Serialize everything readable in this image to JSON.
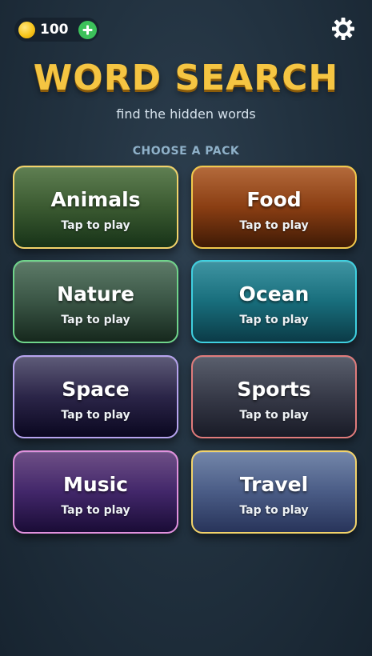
{
  "header": {
    "coins": "100",
    "coin_icon": "coin-icon",
    "add_icon": "plus-circle-icon",
    "settings_icon": "gear-icon"
  },
  "title": "WORD SEARCH",
  "subtitle": "find the hidden words",
  "section_label": "CHOOSE A PACK",
  "packs": [
    {
      "name": "Animals",
      "sub": "Tap to play",
      "border": "#f2d36a"
    },
    {
      "name": "Food",
      "sub": "Tap to play",
      "border": "#f2c94c"
    },
    {
      "name": "Nature",
      "sub": "Tap to play",
      "border": "#6fd48a"
    },
    {
      "name": "Ocean",
      "sub": "Tap to play",
      "border": "#3fd0e0"
    },
    {
      "name": "Space",
      "sub": "Tap to play",
      "border": "#b6a3ee"
    },
    {
      "name": "Sports",
      "sub": "Tap to play",
      "border": "#e07b7b"
    },
    {
      "name": "Music",
      "sub": "Tap to play",
      "border": "#e191de"
    },
    {
      "name": "Travel",
      "sub": "Tap to play",
      "border": "#f2d36a"
    }
  ],
  "colors": {
    "title": "#f5c542",
    "background": "#223240",
    "section_label": "#8fb1c9",
    "add_button": "#3cc15a"
  }
}
